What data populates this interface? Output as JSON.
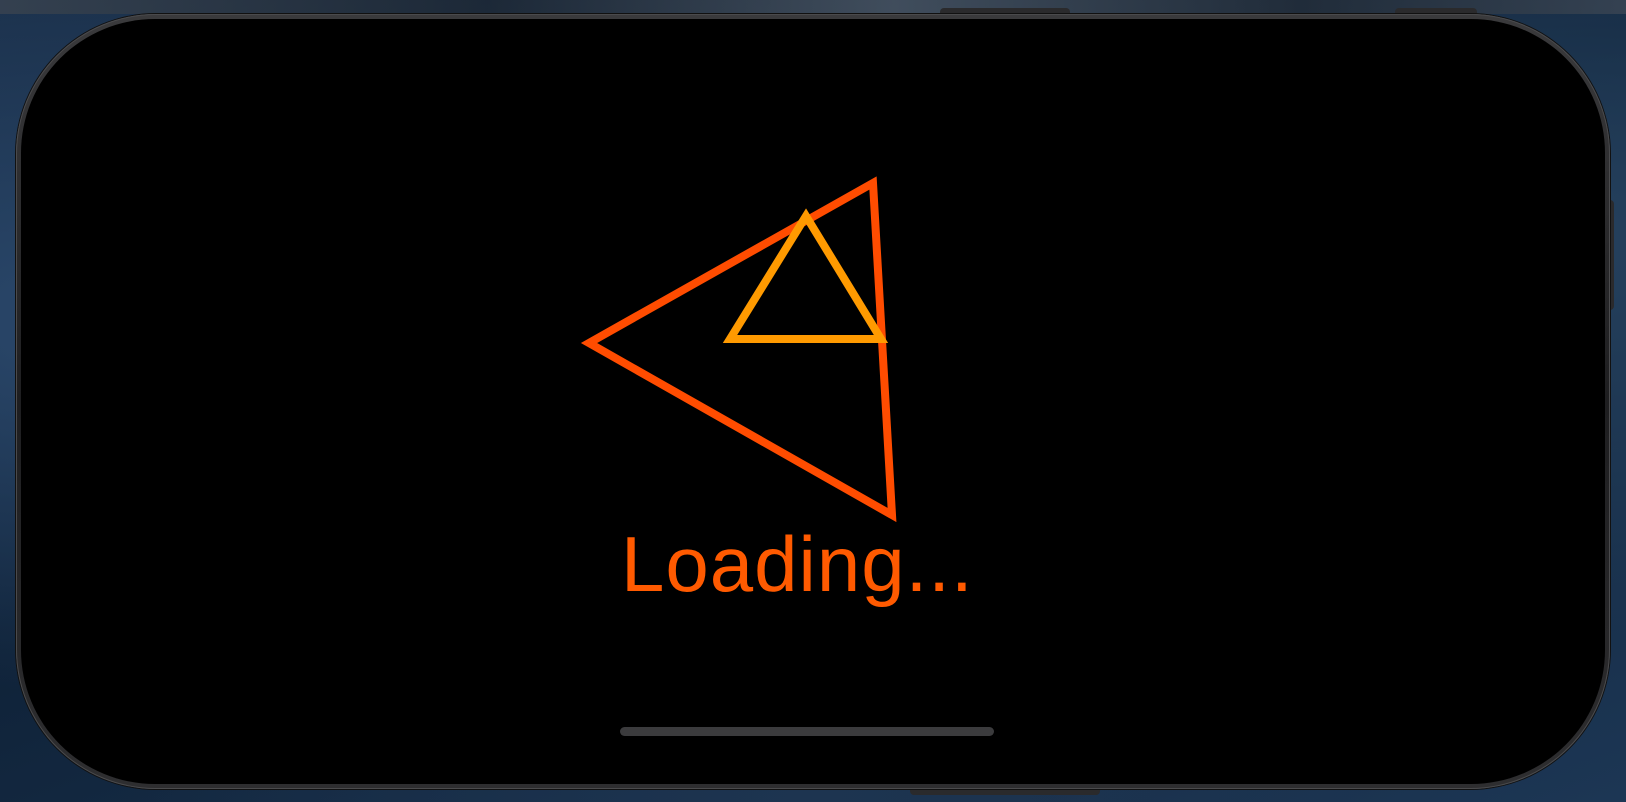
{
  "app": {
    "screen": "loading-screen"
  },
  "loader": {
    "text": "Loading...",
    "colors": {
      "outer_triangle": "#ff4c00",
      "inner_triangle": "#ff9a00",
      "text": "#ff5a00",
      "background": "#000000"
    },
    "icons": [
      "outer-triangle-icon",
      "inner-triangle-icon"
    ]
  },
  "device": {
    "home_indicator": "home-indicator"
  }
}
